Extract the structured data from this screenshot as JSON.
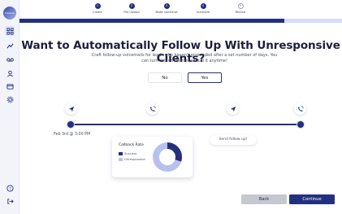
{
  "sidebar": {
    "logo_text": "Pipeline",
    "icons": [
      "grid-icon",
      "activity-icon",
      "voicemail-icon",
      "contacts-icon",
      "billing-icon",
      "settings-icon"
    ],
    "bottom_icons": [
      "help-icon",
      "logout-icon"
    ]
  },
  "stepper": {
    "steps": [
      {
        "number": "1",
        "label": "Create",
        "state": "done"
      },
      {
        "number": "2",
        "label": "File Upload",
        "state": "done"
      },
      {
        "number": "3",
        "label": "Make voicemail",
        "state": "done"
      },
      {
        "number": "4",
        "label": "Schedule",
        "state": "done"
      },
      {
        "number": "5",
        "label": "Review",
        "state": "pending"
      }
    ],
    "progress": 0.82
  },
  "main": {
    "title": "Want to Automatically Follow Up With Unresponsive Clients?",
    "subtitle": "Craft follow-up voicemails for leads who haven't responded after a set number of days. You can turn this on later or cancel it anytime!",
    "no_label": "No",
    "yes_label": "Yes",
    "selected": "Yes"
  },
  "timeline": {
    "date_label": "Feb 3rd @ 3:00 PM",
    "send_follow_up": "Send follow up!"
  },
  "card": {
    "title": "Callback Rate",
    "legend": [
      {
        "label": "Success",
        "color": "#23307e"
      },
      {
        "label": "Unresponsive",
        "color": "#b7c1ef"
      }
    ],
    "success_fraction": 0.3
  },
  "footer": {
    "back_label": "Back",
    "continue_label": "Continue"
  },
  "colors": {
    "accent": "#23307e",
    "accent_light": "#b7c1ef",
    "track": "#d5dcfb"
  }
}
